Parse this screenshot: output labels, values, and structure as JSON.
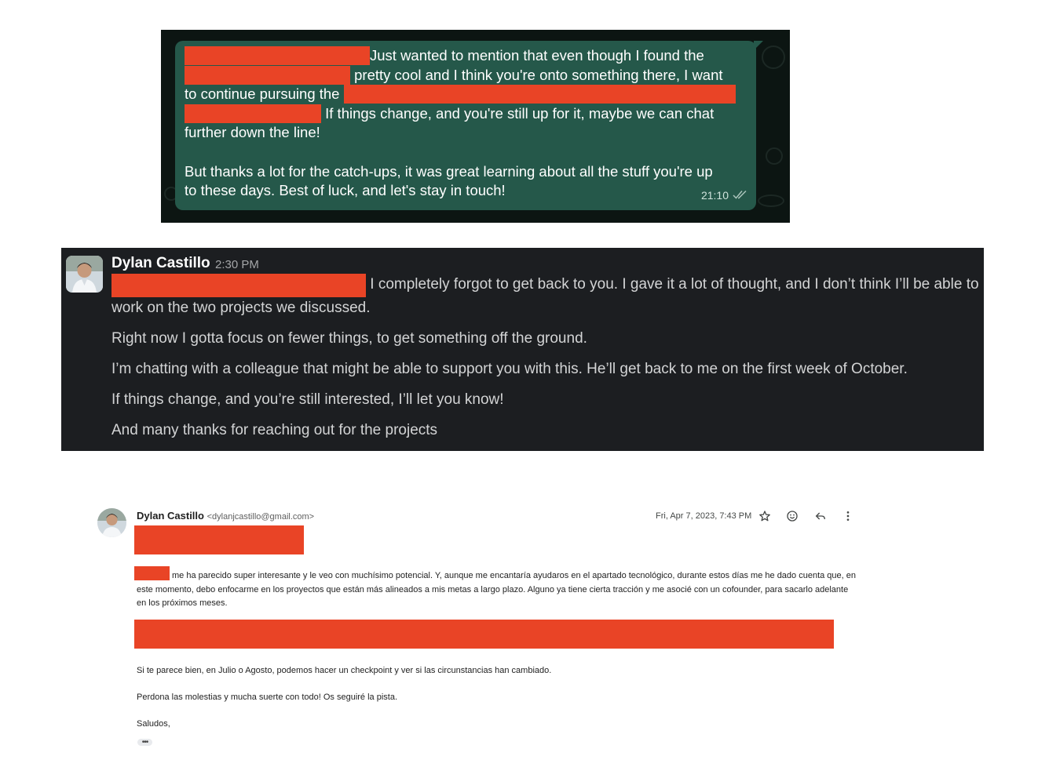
{
  "whatsapp": {
    "lines": [
      {
        "redact": 236,
        "text": "Just wanted to mention that even though I found the"
      },
      {
        "redact": 211,
        "text": " pretty cool and I think you're onto something there, I want"
      },
      {
        "text": "to continue pursuing the ",
        "redact_after": 499
      },
      {
        "redact": 174,
        "text": " If things change, and you're still up for it, maybe we can chat"
      },
      {
        "text": "further down the line!"
      },
      {
        "text": ""
      },
      {
        "text": "But thanks a lot for the catch-ups, it was great learning about all the stuff you're up"
      },
      {
        "text": "to these days. Best of luck, and let's stay in touch!"
      }
    ],
    "time": "21:10",
    "status_icon": "double-check-icon",
    "colors": {
      "background": "#0c1512",
      "bubble": "#25584a",
      "redaction": "#e94426"
    }
  },
  "slack": {
    "sender": "Dylan Castillo",
    "time": "2:30 PM",
    "first_line_redact": 324,
    "paragraphs": [
      "I completely forgot to get back to you. I gave it a lot of thought, and I don’t think I’ll be able to work on the two projects we discussed.",
      "Right now I gotta focus on fewer things, to get something off the ground.",
      "I’m chatting with a colleague that might be able to support you with this. He’ll get back to me on the first week of October.",
      "If things change, and you’re still interested, I’ll let you know!",
      "And many thanks for reaching out for the projects"
    ],
    "colors": {
      "background": "#1c1e21",
      "text": "#d3d4d5"
    }
  },
  "gmail": {
    "sender_name": "Dylan Castillo",
    "sender_email": "<dylanjcastillo@gmail.com>",
    "date": "Fri, Apr 7, 2023, 7:43 PM",
    "icons": [
      "star-icon",
      "emoji-icon",
      "reply-icon",
      "more-vert-icon"
    ],
    "para1": "me ha parecido super interesante y le veo con muchísimo potencial. Y, aunque me encantaría ayudaros en el apartado tecnológico, durante estos días me he dado cuenta que, en este momento, debo enfocarme en los proyectos que están más alineados a mis metas a largo plazo. Alguno ya tiene cierta tracción y me asocié con un cofounder, para sacarlo adelante en los próximos meses.",
    "line_checkpoint": "Si te parece bien, en Julio o Agosto, podemos hacer un checkpoint y ver si las circunstancias han cambiado.",
    "line_sorry": "Perdona las molestias y mucha suerte con todo! Os seguiré la pista.",
    "signoff": "Saludos,",
    "more_dots": "•••"
  }
}
